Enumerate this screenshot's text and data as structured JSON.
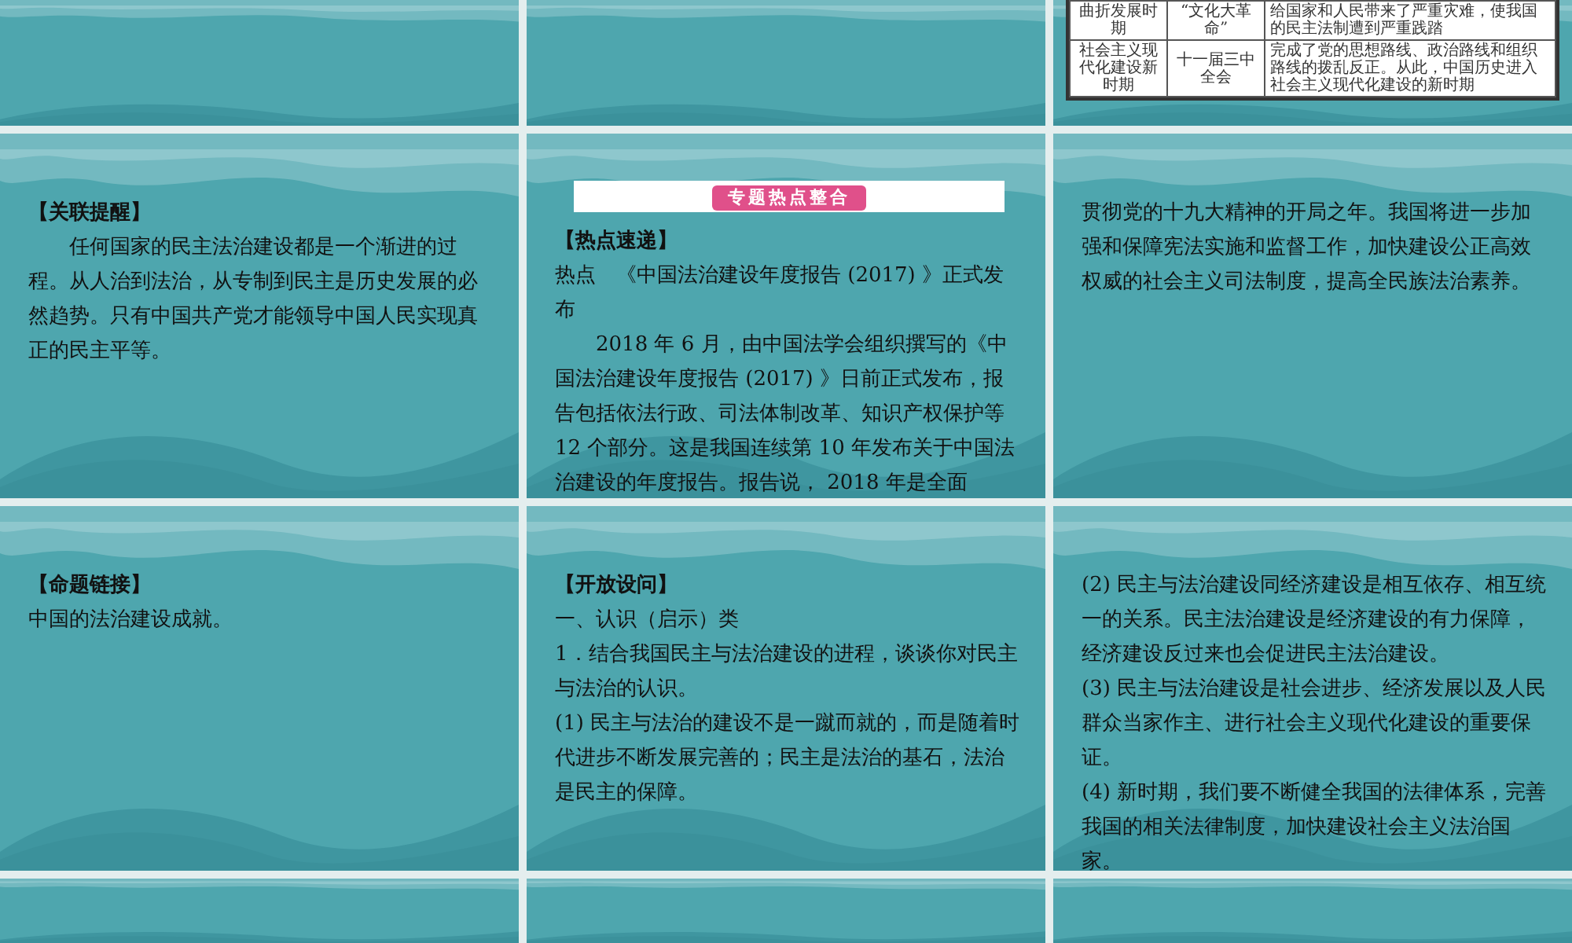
{
  "slides": [
    {
      "kind": "blank"
    },
    {
      "kind": "blank"
    },
    {
      "kind": "table",
      "rows": [
        {
          "cells": [
            "曲折发展时期",
            "“文化大革命”",
            "给国家和人民带来了严重灾难，使我国的民主法制遭到严重践踏"
          ]
        },
        {
          "cells": [
            "社会主义现代化建设新时期",
            "十一届三中全会",
            "完成了党的思想路线、政治路线和组织路线的拨乱反正。从此，中国历史进入社会主义现代化建设的新时期"
          ]
        }
      ]
    },
    {
      "kind": "text",
      "paragraphs": [
        {
          "kind": "heading",
          "text": "【关联提醒】"
        },
        {
          "kind": "indented",
          "text": "任何国家的民主法治建设都是一个渐进的过程。从人治到法治，从专制到民主是历史发展的必然趋势。只有中国共产党才能领导中国人民实现真正的民主平等。"
        }
      ]
    },
    {
      "kind": "text",
      "paragraphs": [
        {
          "kind": "banner",
          "text": "专题热点整合"
        },
        {
          "kind": "heading",
          "text": "【热点速递】"
        },
        {
          "kind": "body",
          "text": "热点　《中国法治建设年度报告 (2017) 》正式发布"
        },
        {
          "kind": "indented",
          "text": "2018 年 6 月，由中国法学会组织撰写的《中国法治建设年度报告 (2017) 》日前正式发布，报告包括依法行政、司法体制改革、知识产权保护等 12 个部分。这是我国连续第 10 年发布关于中国法治建设的年度报告。报告说， 2018 年是全面"
        }
      ]
    },
    {
      "kind": "text",
      "paragraphs": [
        {
          "kind": "body",
          "text": "贯彻党的十九大精神的开局之年。我国将进一步加强和保障宪法实施和监督工作，加快建设公正高效权威的社会主义司法制度，提高全民族法治素养。"
        }
      ]
    },
    {
      "kind": "text",
      "paragraphs": [
        {
          "kind": "heading",
          "text": "【命题链接】"
        },
        {
          "kind": "body",
          "text": "中国的法治建设成就。"
        }
      ]
    },
    {
      "kind": "text",
      "paragraphs": [
        {
          "kind": "heading",
          "text": "【开放设问】"
        },
        {
          "kind": "body",
          "text": "一、认识（启示）类"
        },
        {
          "kind": "body",
          "text": "1．结合我国民主与法治建设的进程，谈谈你对民主与法治的认识。"
        },
        {
          "kind": "body",
          "text": "(1) 民主与法治的建设不是一蹴而就的，而是随着时代进步不断发展完善的；民主是法治的基石，法治是民主的保障。"
        }
      ]
    },
    {
      "kind": "text",
      "paragraphs": [
        {
          "kind": "body",
          "text": "(2) 民主与法治建设同经济建设是相互依存、相互统一的关系。民主法治建设是经济建设的有力保障，经济建设反过来也会促进民主法治建设。"
        },
        {
          "kind": "body",
          "text": "(3) 民主与法治建设是社会进步、经济发展以及人民群众当家作主、进行社会主义现代化建设的重要保证。"
        },
        {
          "kind": "body",
          "text": "(4) 新时期，我们要不断健全我国的法律体系，完善我国的相关法律制度，加快建设社会主义法治国家。"
        }
      ]
    },
    {
      "kind": "blank"
    },
    {
      "kind": "blank"
    },
    {
      "kind": "blank"
    }
  ]
}
